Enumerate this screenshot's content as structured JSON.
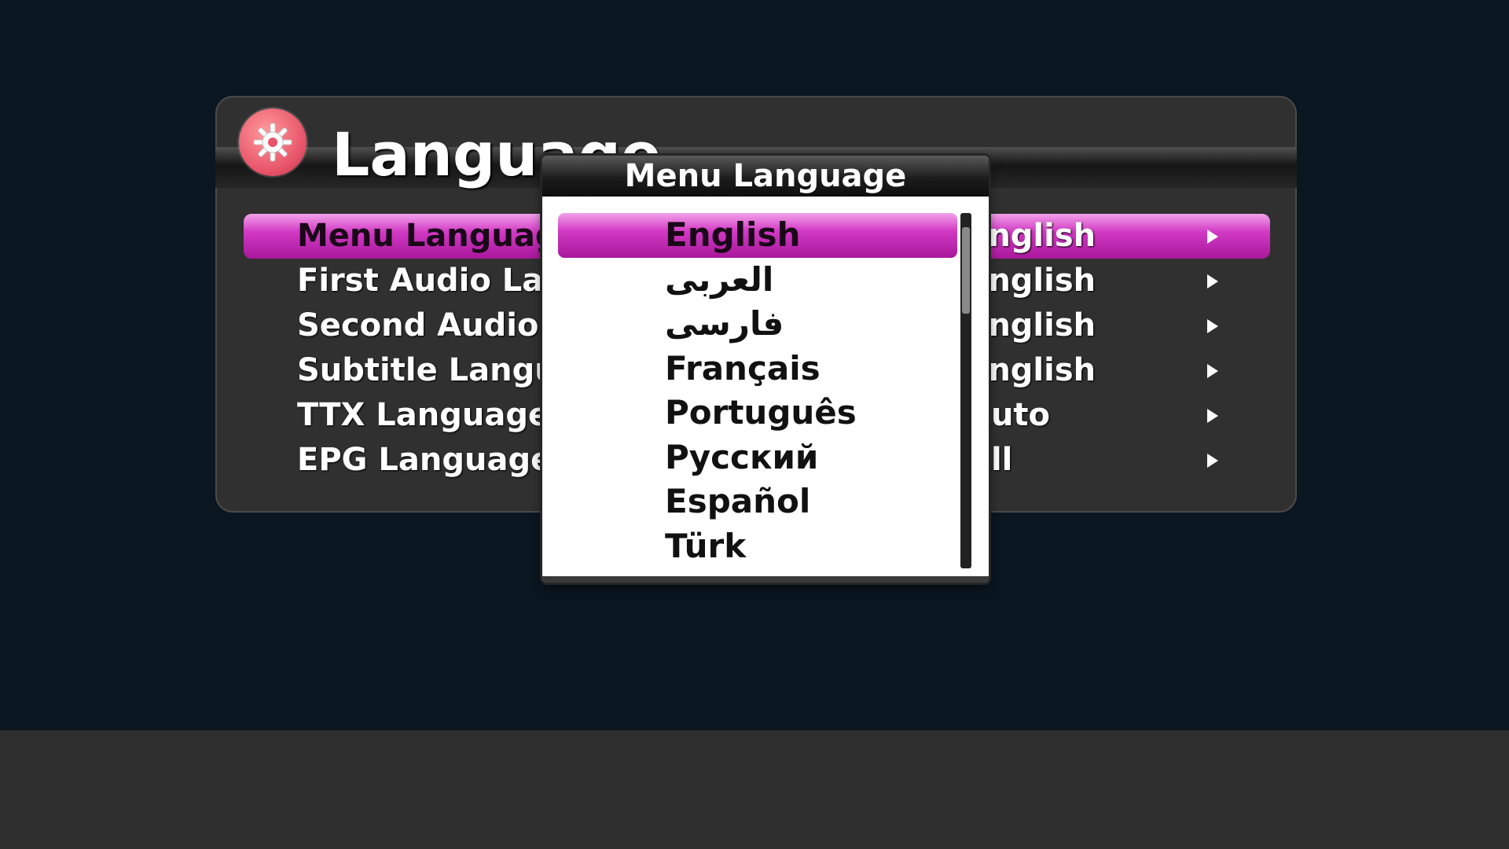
{
  "panel": {
    "title": "Language",
    "icon": "gear-icon",
    "rows": [
      {
        "label": "Menu Language",
        "value": "English"
      },
      {
        "label": "First Audio Language",
        "value": "English"
      },
      {
        "label": "Second Audio Language",
        "value": "English"
      },
      {
        "label": "Subtitle Language",
        "value": "English"
      },
      {
        "label": "TTX Language",
        "value": "Auto"
      },
      {
        "label": "EPG Language",
        "value": "All"
      }
    ],
    "selected_index": 0
  },
  "popup": {
    "title": "Menu Language",
    "items": [
      "English",
      "العربى",
      "فارسى",
      "Français",
      "Português",
      "Русский",
      "Español",
      "Türk"
    ],
    "selected_index": 0
  },
  "colors": {
    "highlight": "#d23ac4",
    "background": "#0a1620",
    "panel": "#303030"
  }
}
